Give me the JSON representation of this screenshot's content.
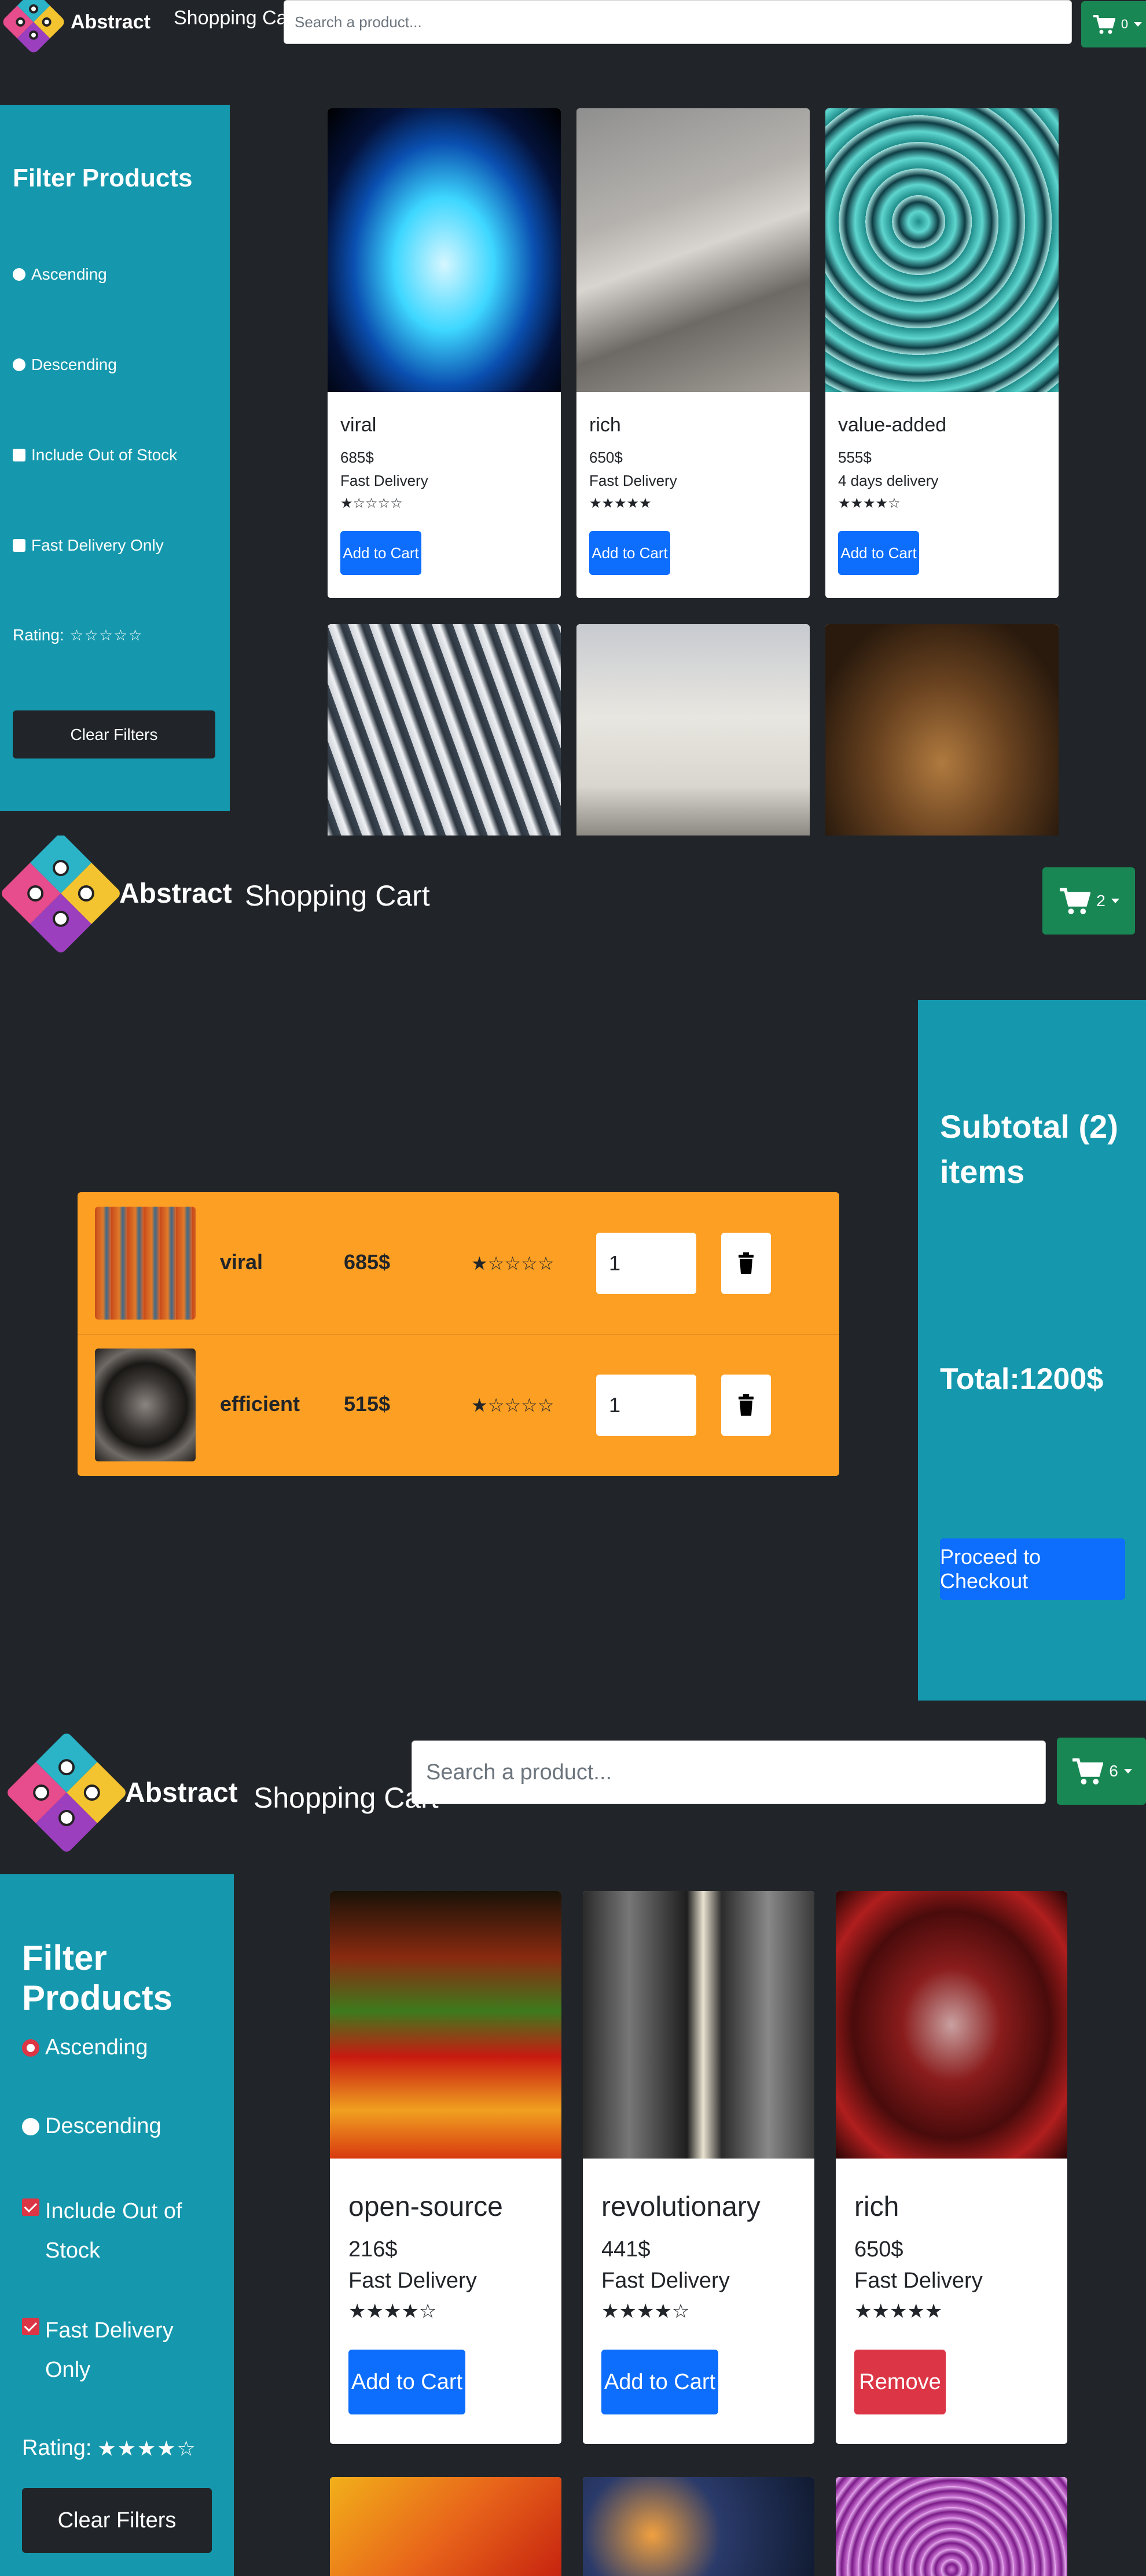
{
  "brand": {
    "name": "Abstract",
    "nav_title": "Shopping Cart"
  },
  "search": {
    "placeholder": "Search a product..."
  },
  "filters": {
    "title": "Filter Products",
    "ascending": "Ascending",
    "descending": "Descending",
    "include_out_of_stock": "Include Out of Stock",
    "fast_delivery_only": "Fast Delivery Only",
    "fast_delivery_line1": "Fast Delivery",
    "fast_delivery_line2": "Only",
    "include_line1": "Include Out of",
    "include_line2": "Stock",
    "rating_label": "Rating:",
    "clear": "Clear Filters"
  },
  "screen1": {
    "cart_count": "0",
    "rating_stars": "☆☆☆☆☆",
    "products": [
      {
        "name": "viral",
        "price": "685$",
        "delivery": "Fast Delivery",
        "stars": "★☆☆☆☆",
        "button": "Add to Cart"
      },
      {
        "name": "rich",
        "price": "650$",
        "delivery": "Fast Delivery",
        "stars": "★★★★★",
        "button": "Add to Cart"
      },
      {
        "name": "value-added",
        "price": "555$",
        "delivery": "4 days delivery",
        "stars": "★★★★☆",
        "button": "Add to Cart"
      }
    ]
  },
  "screen2": {
    "cart_count": "2",
    "items": [
      {
        "name": "viral",
        "price": "685$",
        "stars": "★☆☆☆☆",
        "qty": "1"
      },
      {
        "name": "efficient",
        "price": "515$",
        "stars": "★☆☆☆☆",
        "qty": "1"
      }
    ],
    "subtotal_line1": "Subtotal (2)",
    "subtotal_line2": "items",
    "total": "Total:1200$",
    "checkout": "Proceed to Checkout"
  },
  "screen3": {
    "cart_count": "6",
    "rating_stars": "★★★★☆",
    "products": [
      {
        "name": "open-source",
        "price": "216$",
        "delivery": "Fast Delivery",
        "stars": "★★★★☆",
        "button": "Add to Cart"
      },
      {
        "name": "revolutionary",
        "price": "441$",
        "delivery": "Fast Delivery",
        "stars": "★★★★☆",
        "button": "Add to Cart"
      },
      {
        "name": "rich",
        "price": "650$",
        "delivery": "Fast Delivery",
        "stars": "★★★★★",
        "button": "Remove"
      }
    ]
  },
  "colors": {
    "panel": "#1598ad",
    "background": "#212529",
    "cart_button": "#198754",
    "primary": "#0d6efd",
    "danger": "#dc3545",
    "cart_list": "#fd9f23"
  },
  "icons": {
    "cart": "cart-icon",
    "trash": "trash-icon",
    "caret": "caret-down-icon"
  }
}
